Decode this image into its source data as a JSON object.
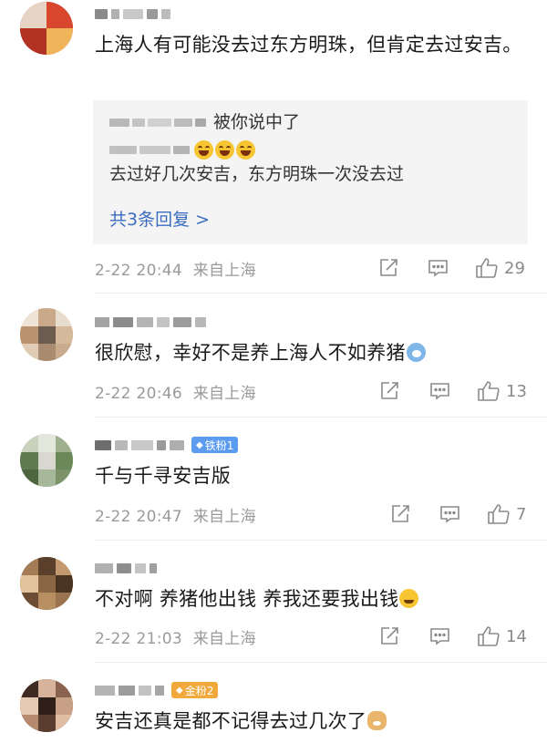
{
  "comments": [
    {
      "body": "上海人有可能没去过东方明珠，但肯定去过安吉。",
      "badge": null,
      "replies": [
        {
          "text": "被你说中了"
        },
        {
          "text": "去过好几次安吉，东方明珠一次没去过",
          "emoji_prefix": [
            "laugh",
            "laugh",
            "laugh"
          ]
        }
      ],
      "more_replies": "共3条回复 >",
      "time": "2-22 20:44",
      "location": "来自上海",
      "likes": "29"
    },
    {
      "body": "很欣慰，幸好不是养上海人不如养猪",
      "body_emoji": "pig",
      "badge": null,
      "time": "2-22 20:46",
      "location": "来自上海",
      "likes": "13"
    },
    {
      "body": "千与千寻安吉版",
      "badge": {
        "label": "铁粉1",
        "color": "#5b9cf0"
      },
      "time": "2-22 20:47",
      "location": "来自上海",
      "likes": "7"
    },
    {
      "body": "不对啊 养猪他出钱 养我还要我出钱",
      "body_emoji": "sweat",
      "badge": null,
      "time": "2-22 21:03",
      "location": "来自上海",
      "likes": "14"
    },
    {
      "body": "安吉还真是都不记得去过几次了",
      "body_emoji": "dog",
      "badge": {
        "label": "金粉2",
        "color": "#f0a93a"
      }
    }
  ],
  "icons": {
    "share": "share-icon",
    "reply": "comment-icon",
    "like": "thumbs-up-icon"
  },
  "colors": {
    "link": "#3a6cc0",
    "meta_text": "#9a9a9a",
    "reply_bg": "#f4f4f4"
  }
}
